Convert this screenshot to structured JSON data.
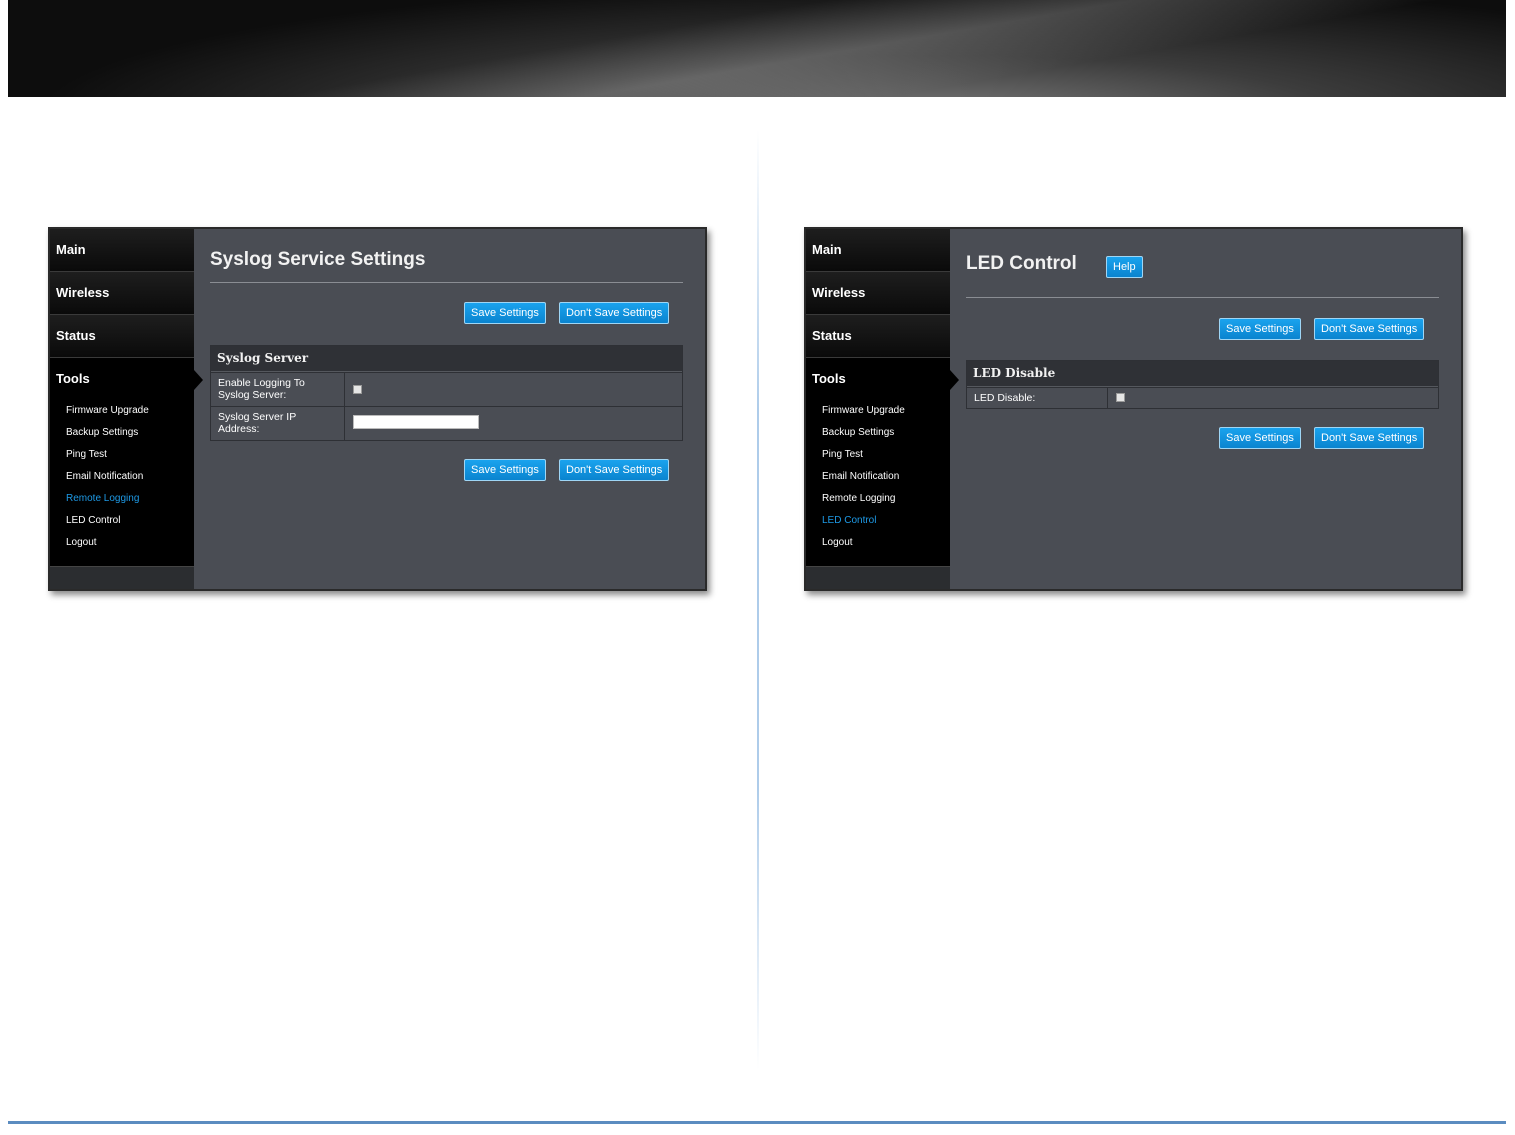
{
  "nav": {
    "main": "Main",
    "wireless": "Wireless",
    "status": "Status",
    "tools": "Tools",
    "sub_items": [
      "Firmware Upgrade",
      "Backup Settings",
      "Ping Test",
      "Email Notification",
      "Remote Logging",
      "LED Control",
      "Logout"
    ]
  },
  "left_panel": {
    "title": "Syslog Service Settings",
    "save_label": "Save Settings",
    "dont_save_label": "Don't Save Settings",
    "section_title": "Syslog Server",
    "enable_label": "Enable Logging To Syslog Server:",
    "ip_label": "Syslog Server IP Address:",
    "ip_value": "",
    "active_item": "Remote Logging"
  },
  "right_panel": {
    "title": "LED Control",
    "help_label": "Help",
    "save_label": "Save Settings",
    "dont_save_label": "Don't Save Settings",
    "section_title": "LED Disable",
    "led_label": "LED Disable:",
    "active_item": "LED Control"
  },
  "colors": {
    "accent": "#0a84cf",
    "active_link": "#1e9ae6",
    "panel_bg": "#4a4d54"
  }
}
